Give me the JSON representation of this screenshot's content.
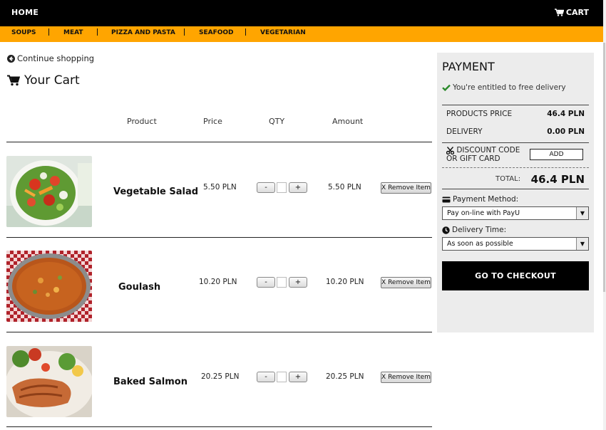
{
  "nav": {
    "home": "HOME",
    "cart": "CART"
  },
  "categories": [
    "SOUPS",
    "MEAT",
    "PIZZA AND PASTA",
    "SEAFOOD",
    "VEGETARIAN"
  ],
  "continue_shopping": "Continue shopping",
  "cart_title": "Your Cart",
  "table_headers": {
    "product": "Product",
    "price": "Price",
    "qty": "QTY",
    "amount": "Amount"
  },
  "items": [
    {
      "name": "Vegetable Salad",
      "price": "5.50 PLN",
      "amount": "5.50 PLN",
      "remove": "X Remove Item",
      "qty_minus": "-",
      "qty_plus": "+"
    },
    {
      "name": "Goulash",
      "price": "10.20 PLN",
      "amount": "10.20 PLN",
      "remove": "X Remove Item",
      "qty_minus": "-",
      "qty_plus": "+"
    },
    {
      "name": "Baked Salmon",
      "price": "20.25 PLN",
      "amount": "20.25 PLN",
      "remove": "X Remove Item",
      "qty_minus": "-",
      "qty_plus": "+"
    }
  ],
  "payment": {
    "title": "PAYMENT",
    "free_delivery": "You're entitled to free delivery",
    "products_price_label": "PRODUCTS PRICE",
    "products_price_value": "46.4 PLN",
    "delivery_label": "DELIVERY",
    "delivery_value": "0.00 PLN",
    "discount_line1": "DISCOUNT CODE",
    "discount_line2": "OR GIFT CARD",
    "add_button": "ADD",
    "total_label": "TOTAL:",
    "total_value": "46.4 PLN",
    "payment_method_label": "Payment Method:",
    "payment_method_value": "Pay on-line with PayU",
    "delivery_time_label": "Delivery Time:",
    "delivery_time_value": "As soon as possible",
    "checkout_button": "GO TO CHECKOUT"
  },
  "colors": {
    "topbar": "#000000",
    "category_bar": "#ffa500",
    "panel": "#ececec",
    "check": "#2a8a2a"
  }
}
